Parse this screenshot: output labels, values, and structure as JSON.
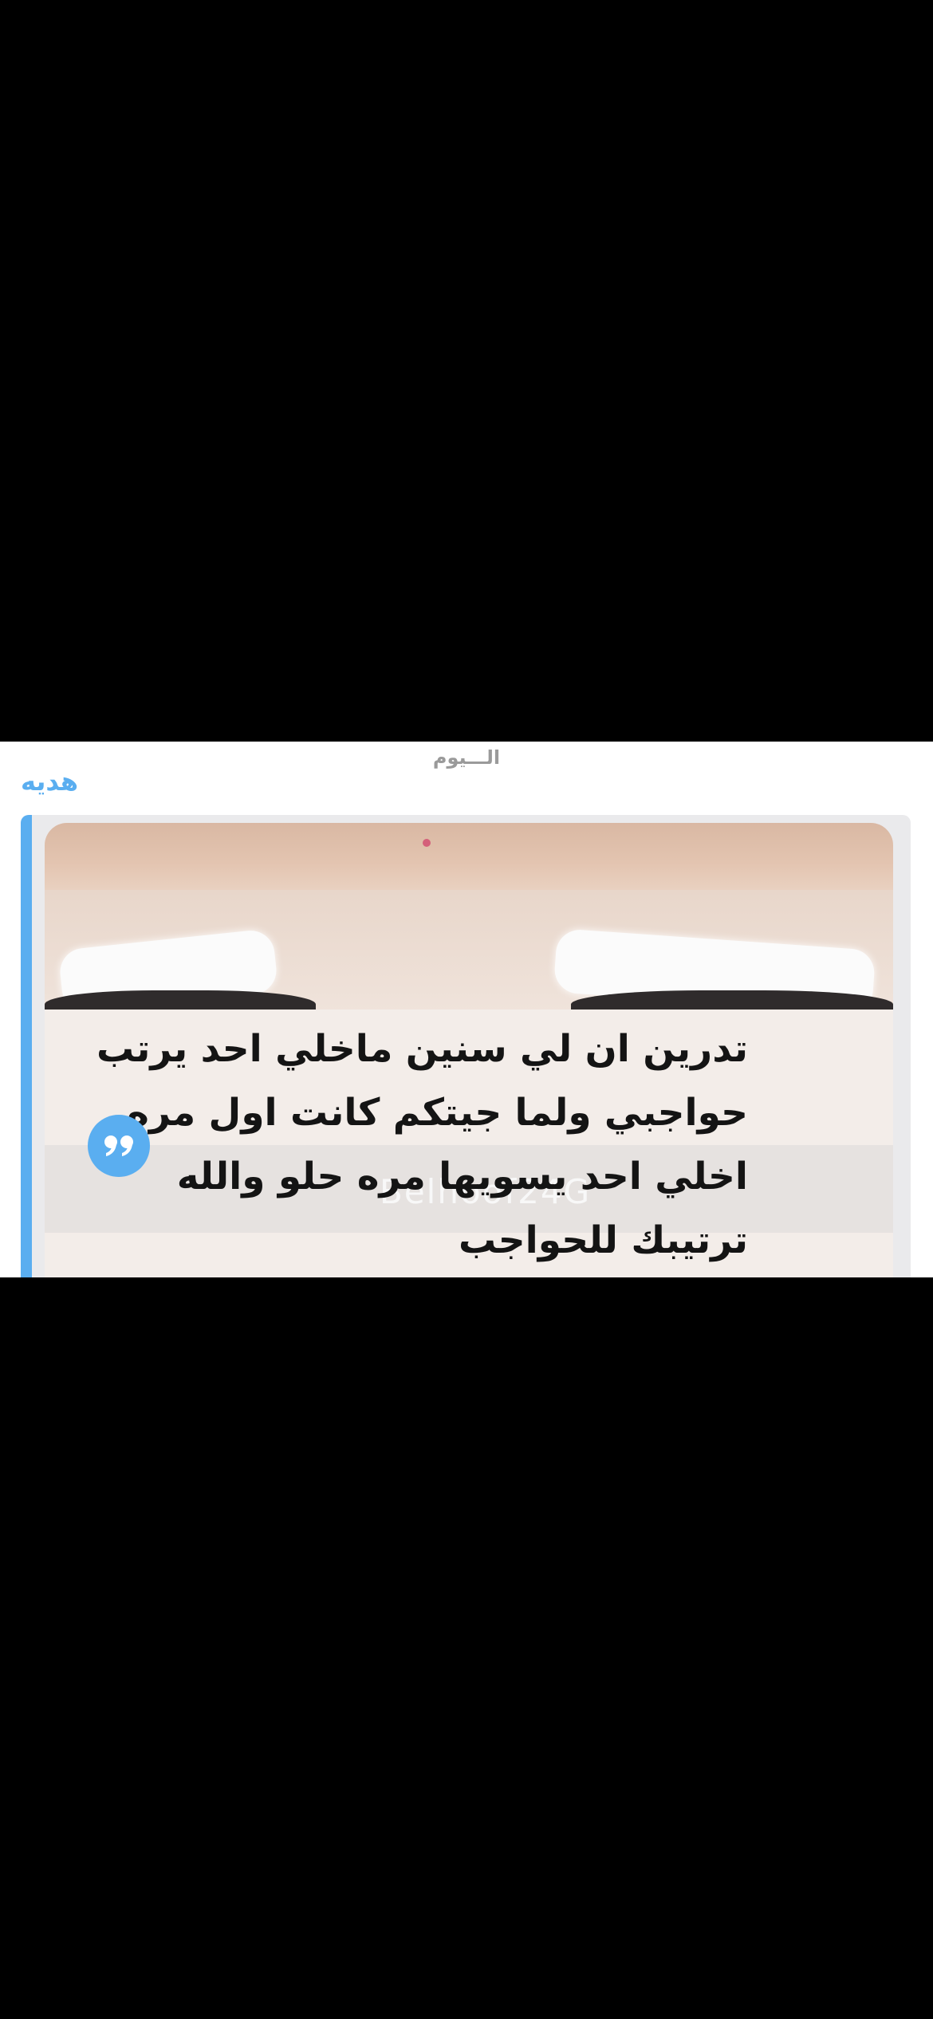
{
  "chat": {
    "date_divider": "الـــيوم",
    "sender_name": "هديه",
    "quote": {
      "text": "تدرين ان لي سنين ماخلي احد يرتب حواجبي ولما جيتكم كانت اول مره اخلي احد يسويها مره حلو والله ترتيبك للحواجب",
      "icon": "quote-icon"
    },
    "photo_watermark": "Belhoof24G"
  },
  "colors": {
    "accent": "#5aaef0",
    "background": "#000000",
    "panel": "#ffffff",
    "date_text": "#9a9a9a",
    "quote_text": "#141414"
  }
}
